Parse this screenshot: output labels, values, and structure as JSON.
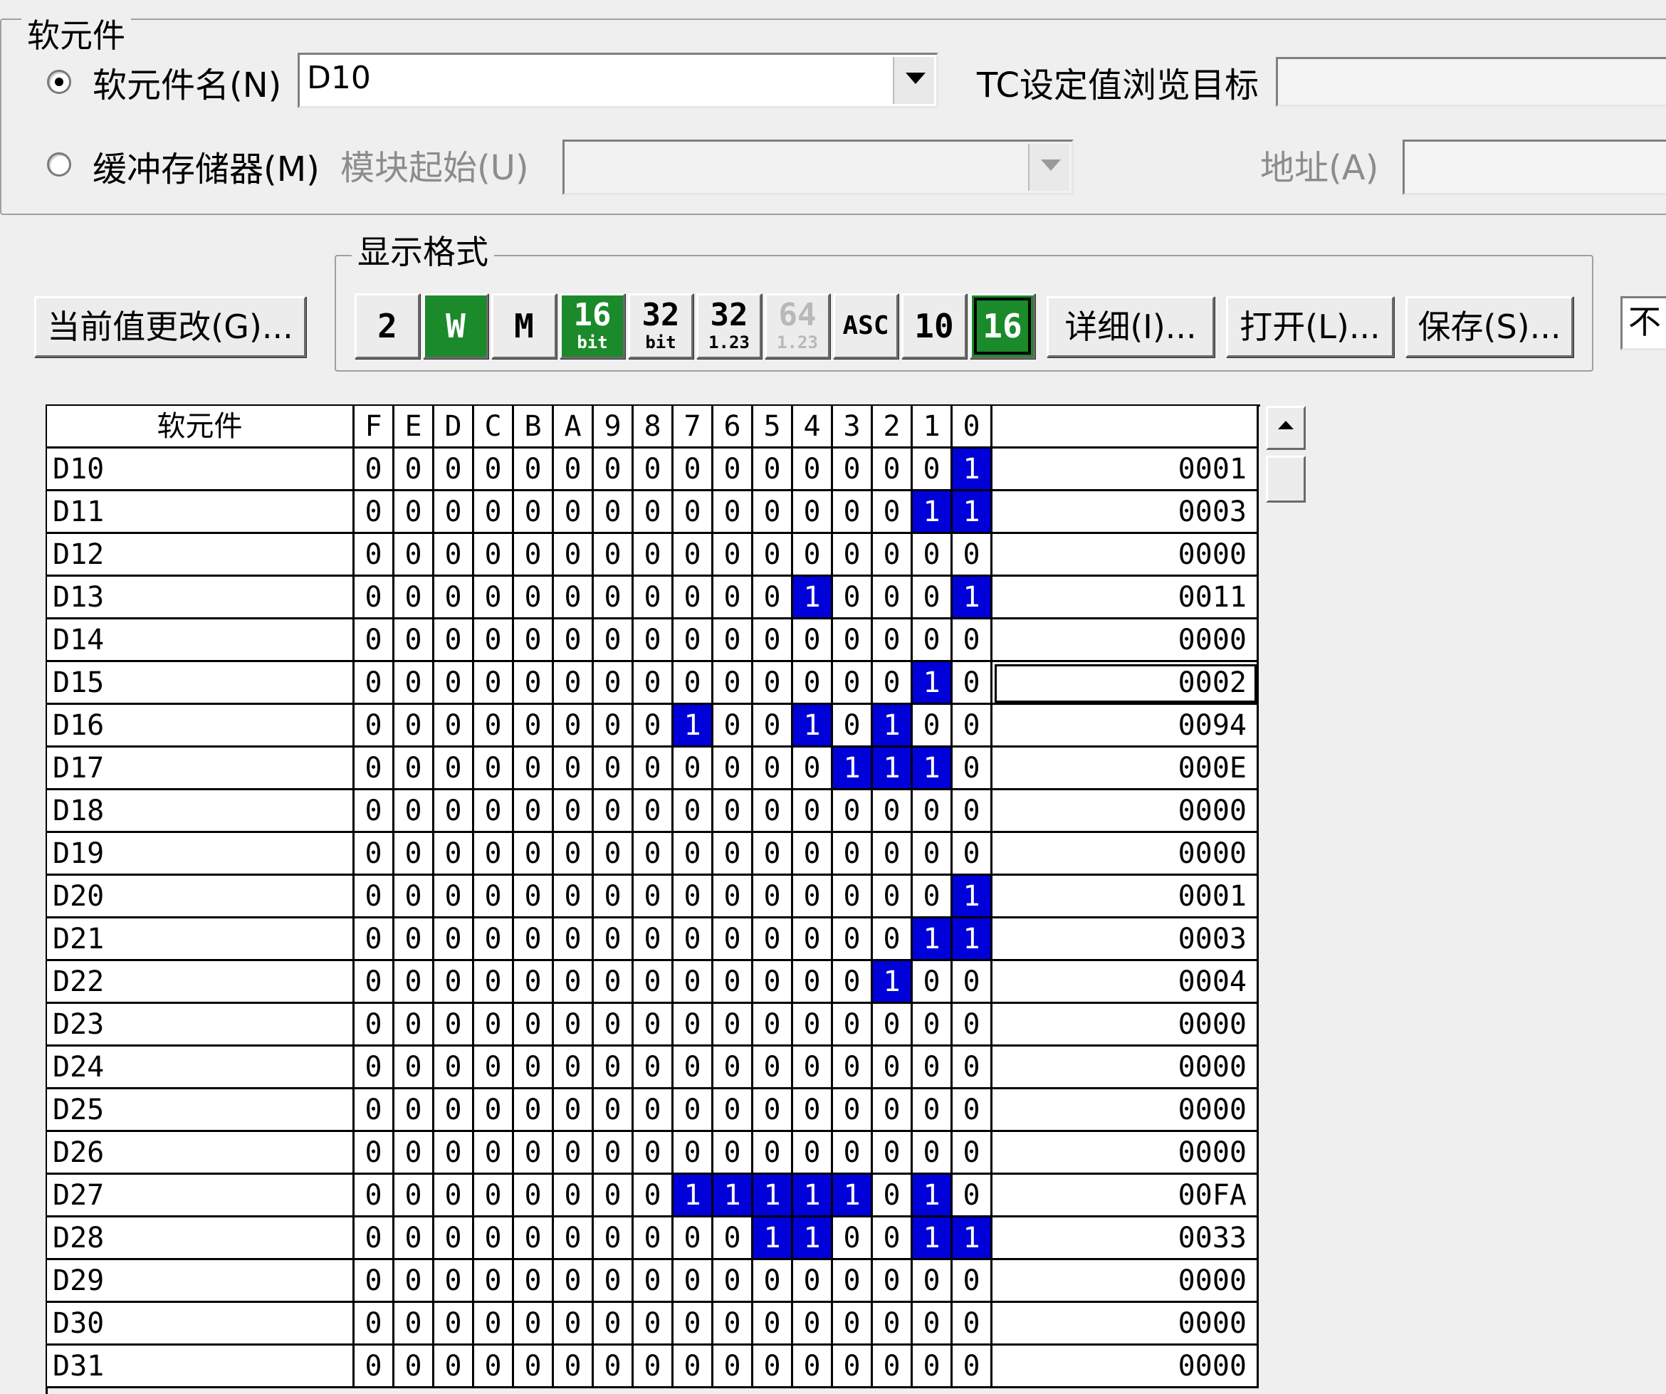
{
  "device_group": {
    "title": "软元件",
    "radio_device_label": "软元件名(N)",
    "device_value": "D10",
    "tc_label": "TC设定值浏览目标",
    "radio_buffer_label": "缓冲存储器(M)",
    "module_start_label": "模块起始(U)",
    "address_label": "地址(A)"
  },
  "toolbar": {
    "change_value_label": "当前值更改(G)...",
    "display_format_title": "显示格式",
    "format_buttons": [
      {
        "id": "bin",
        "big": "2",
        "small": ""
      },
      {
        "id": "word",
        "big": "W",
        "small": ""
      },
      {
        "id": "mw",
        "big": "M",
        "small": ""
      },
      {
        "id": "16bit",
        "big": "16",
        "small": "bit"
      },
      {
        "id": "32bit",
        "big": "32",
        "small": "bit"
      },
      {
        "id": "32float",
        "big": "32",
        "small": "1.23"
      },
      {
        "id": "64float",
        "big": "64",
        "small": "1.23"
      },
      {
        "id": "asc",
        "big": "ASC",
        "small": ""
      },
      {
        "id": "dec",
        "big": "10",
        "small": ""
      },
      {
        "id": "hex",
        "big": "16",
        "small": ""
      }
    ],
    "detail_label": "详细(I)...",
    "open_label": "打开(L)...",
    "save_label": "保存(S)...",
    "right_field_value": "不"
  },
  "grid": {
    "device_header": "软元件",
    "bit_headers": [
      "F",
      "E",
      "D",
      "C",
      "B",
      "A",
      "9",
      "8",
      "7",
      "6",
      "5",
      "4",
      "3",
      "2",
      "1",
      "0"
    ],
    "rows": [
      {
        "name": "D10",
        "bits": "0000000000000001",
        "hex": "0001"
      },
      {
        "name": "D11",
        "bits": "0000000000000011",
        "hex": "0003"
      },
      {
        "name": "D12",
        "bits": "0000000000000000",
        "hex": "0000"
      },
      {
        "name": "D13",
        "bits": "0000000000010001",
        "hex": "0011"
      },
      {
        "name": "D14",
        "bits": "0000000000000000",
        "hex": "0000"
      },
      {
        "name": "D15",
        "bits": "0000000000000010",
        "hex": "0002"
      },
      {
        "name": "D16",
        "bits": "0000000010010100",
        "hex": "0094"
      },
      {
        "name": "D17",
        "bits": "0000000000001110",
        "hex": "000E"
      },
      {
        "name": "D18",
        "bits": "0000000000000000",
        "hex": "0000"
      },
      {
        "name": "D19",
        "bits": "0000000000000000",
        "hex": "0000"
      },
      {
        "name": "D20",
        "bits": "0000000000000001",
        "hex": "0001"
      },
      {
        "name": "D21",
        "bits": "0000000000000011",
        "hex": "0003"
      },
      {
        "name": "D22",
        "bits": "0000000000000100",
        "hex": "0004"
      },
      {
        "name": "D23",
        "bits": "0000000000000000",
        "hex": "0000"
      },
      {
        "name": "D24",
        "bits": "0000000000000000",
        "hex": "0000"
      },
      {
        "name": "D25",
        "bits": "0000000000000000",
        "hex": "0000"
      },
      {
        "name": "D26",
        "bits": "0000000000000000",
        "hex": "0000"
      },
      {
        "name": "D27",
        "bits": "0000000011111010",
        "hex": "00FA"
      },
      {
        "name": "D28",
        "bits": "0000000000110011",
        "hex": "0033"
      },
      {
        "name": "D29",
        "bits": "0000000000000000",
        "hex": "0000"
      },
      {
        "name": "D30",
        "bits": "0000000000000000",
        "hex": "0000"
      },
      {
        "name": "D31",
        "bits": "0000000000000000",
        "hex": "0000"
      }
    ],
    "on_color": "#0000d8"
  }
}
